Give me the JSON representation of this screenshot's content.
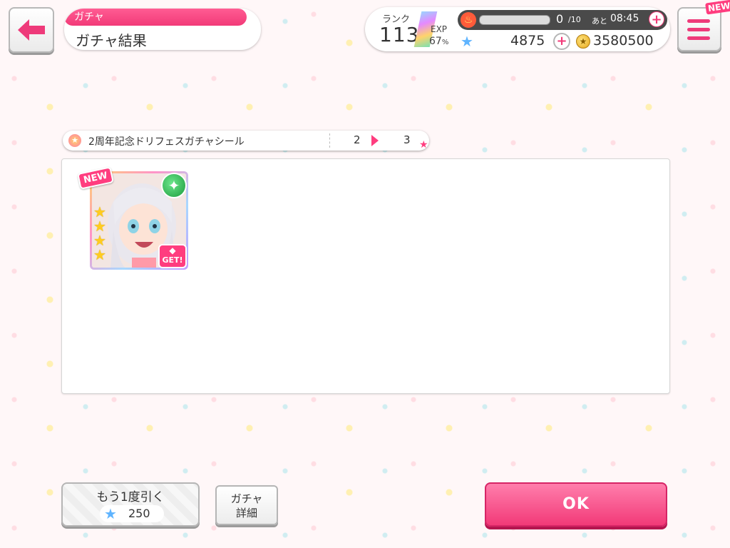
{
  "header": {
    "tag": "ガチャ",
    "title": "ガチャ結果"
  },
  "status": {
    "rank_label": "ランク",
    "rank_value": "113",
    "exp_label": "EXP",
    "exp_value": "67",
    "exp_unit": "%",
    "live_value": "0",
    "live_max": "/10",
    "timer_label": "あと",
    "timer_value": "08:45",
    "star_count": "4875",
    "coin_count": "3580500",
    "plus": "+"
  },
  "menu": {
    "new_label": "NEW"
  },
  "item": {
    "name": "2周年記念ドリフェスガチャシール",
    "from": "2",
    "to": "3"
  },
  "card": {
    "new_label": "NEW",
    "get_label": "GET!",
    "rarity": 4,
    "attribute": "pure",
    "attribute_color": "#2bb34a"
  },
  "buttons": {
    "again_label": "もう1度引く",
    "again_cost": "250",
    "detail_line1": "ガチャ",
    "detail_line2": "詳細",
    "ok_label": "OK"
  },
  "colors": {
    "accent": "#f23a78",
    "star_blue": "#5fb4ff",
    "gold": "#ffcc1f"
  }
}
